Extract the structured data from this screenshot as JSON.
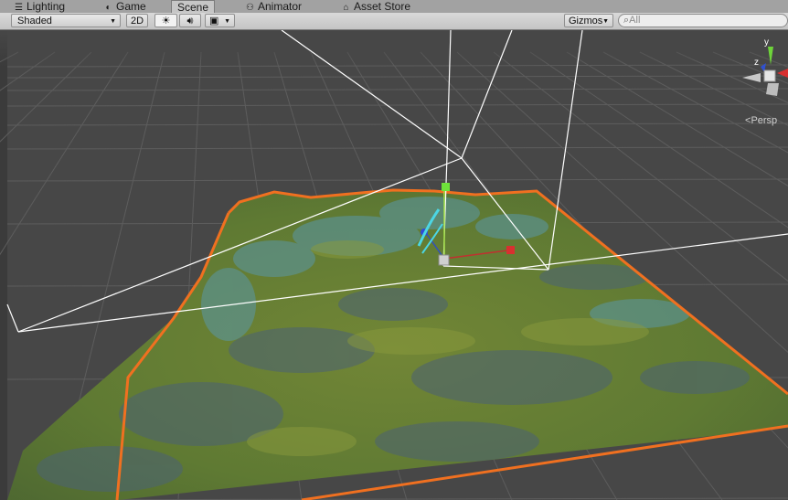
{
  "tabs": [
    {
      "label": "Lighting",
      "icon": "lighting-icon",
      "active": false
    },
    {
      "label": "Game",
      "icon": "game-icon",
      "active": false
    },
    {
      "label": "Scene",
      "icon": "",
      "active": true
    },
    {
      "label": "Animator",
      "icon": "animator-icon",
      "active": false
    },
    {
      "label": "Asset Store",
      "icon": "asset-store-icon",
      "active": false
    }
  ],
  "toolbar": {
    "draw_mode": "Shaded",
    "mode_2d": "2D",
    "gizmos": "Gizmos",
    "search_placeholder": "All"
  },
  "scene": {
    "projection_label": "Persp",
    "axis_y": "y",
    "axis_z": "z"
  },
  "colors": {
    "background": "#474747",
    "grid": "#5e5e5e",
    "selection_outline": "#f07020",
    "terrain_green": "#6d7f34",
    "water": "#5a97a8"
  }
}
